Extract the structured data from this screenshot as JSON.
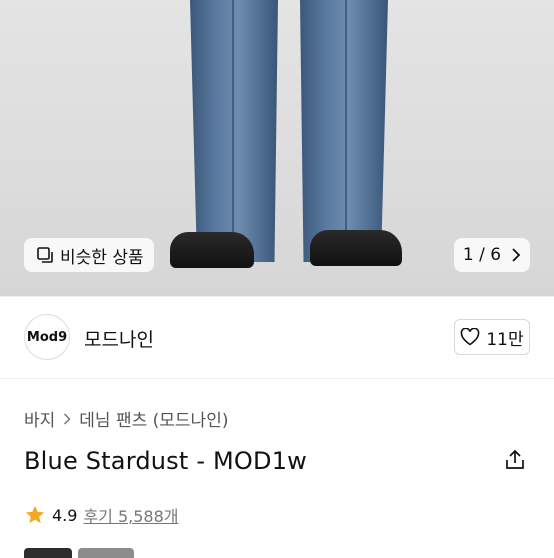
{
  "gallery": {
    "similar_label": "비슷한 상품",
    "pager_current": "1",
    "pager_total": "6",
    "pager_text": "1 / 6"
  },
  "brand": {
    "logo_text": "Mod9",
    "name": "모드나인",
    "like_count": "11만"
  },
  "breadcrumb": {
    "level1": "바지",
    "level2": "데님 팬츠 (모드나인)"
  },
  "product": {
    "title": "Blue Stardust - MOD1w"
  },
  "rating": {
    "score": "4.9",
    "review_label": "후기 5,588개",
    "star_color": "#f5a623"
  },
  "colors": {
    "accent": "#f5a623",
    "denim": "#5a7aa0"
  },
  "icons": [
    "similar-items-icon",
    "chevron-right-icon",
    "heart-icon",
    "share-icon",
    "star-icon"
  ]
}
